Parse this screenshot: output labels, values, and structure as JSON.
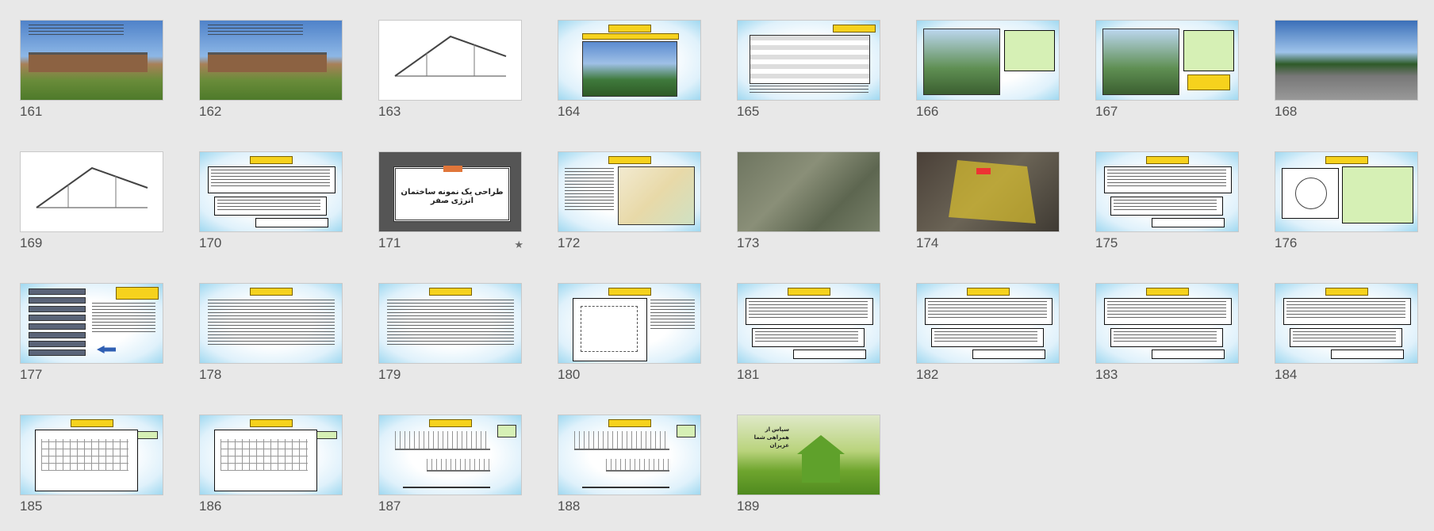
{
  "slides": [
    {
      "number": "161",
      "style": "photo-house"
    },
    {
      "number": "162",
      "style": "photo-campus"
    },
    {
      "number": "163",
      "style": "section-drawing"
    },
    {
      "number": "164",
      "style": "text-photo"
    },
    {
      "number": "165",
      "style": "table"
    },
    {
      "number": "166",
      "style": "photo-left"
    },
    {
      "number": "167",
      "style": "photo-left-yellow"
    },
    {
      "number": "168",
      "style": "photo-parking"
    },
    {
      "number": "169",
      "style": "section-drawing"
    },
    {
      "number": "170",
      "style": "text-boxes"
    },
    {
      "number": "171",
      "style": "title-dark",
      "title": "طراحی یک نمونه ساختمان انرژی صفر",
      "starred": true
    },
    {
      "number": "172",
      "style": "map-text"
    },
    {
      "number": "173",
      "style": "satellite"
    },
    {
      "number": "174",
      "style": "satellite-yellow"
    },
    {
      "number": "175",
      "style": "text-boxes"
    },
    {
      "number": "176",
      "style": "compass"
    },
    {
      "number": "177",
      "style": "flow-list"
    },
    {
      "number": "178",
      "style": "text-only"
    },
    {
      "number": "179",
      "style": "text-only"
    },
    {
      "number": "180",
      "style": "diagram-text"
    },
    {
      "number": "181",
      "style": "text-boxes"
    },
    {
      "number": "182",
      "style": "text-boxes"
    },
    {
      "number": "183",
      "style": "text-boxes"
    },
    {
      "number": "184",
      "style": "text-boxes"
    },
    {
      "number": "185",
      "style": "plan"
    },
    {
      "number": "186",
      "style": "plan"
    },
    {
      "number": "187",
      "style": "elevation"
    },
    {
      "number": "188",
      "style": "elevation"
    },
    {
      "number": "189",
      "style": "green-house",
      "caption": "سپاس از همراهی شما عزیزان"
    }
  ],
  "colors": {
    "background": "#e8e8e8",
    "slide_blue": "#9fd8f0",
    "title_yellow": "#f6d21d",
    "box_green": "#d6f0b5"
  },
  "icons": {
    "starred": "star-icon"
  }
}
